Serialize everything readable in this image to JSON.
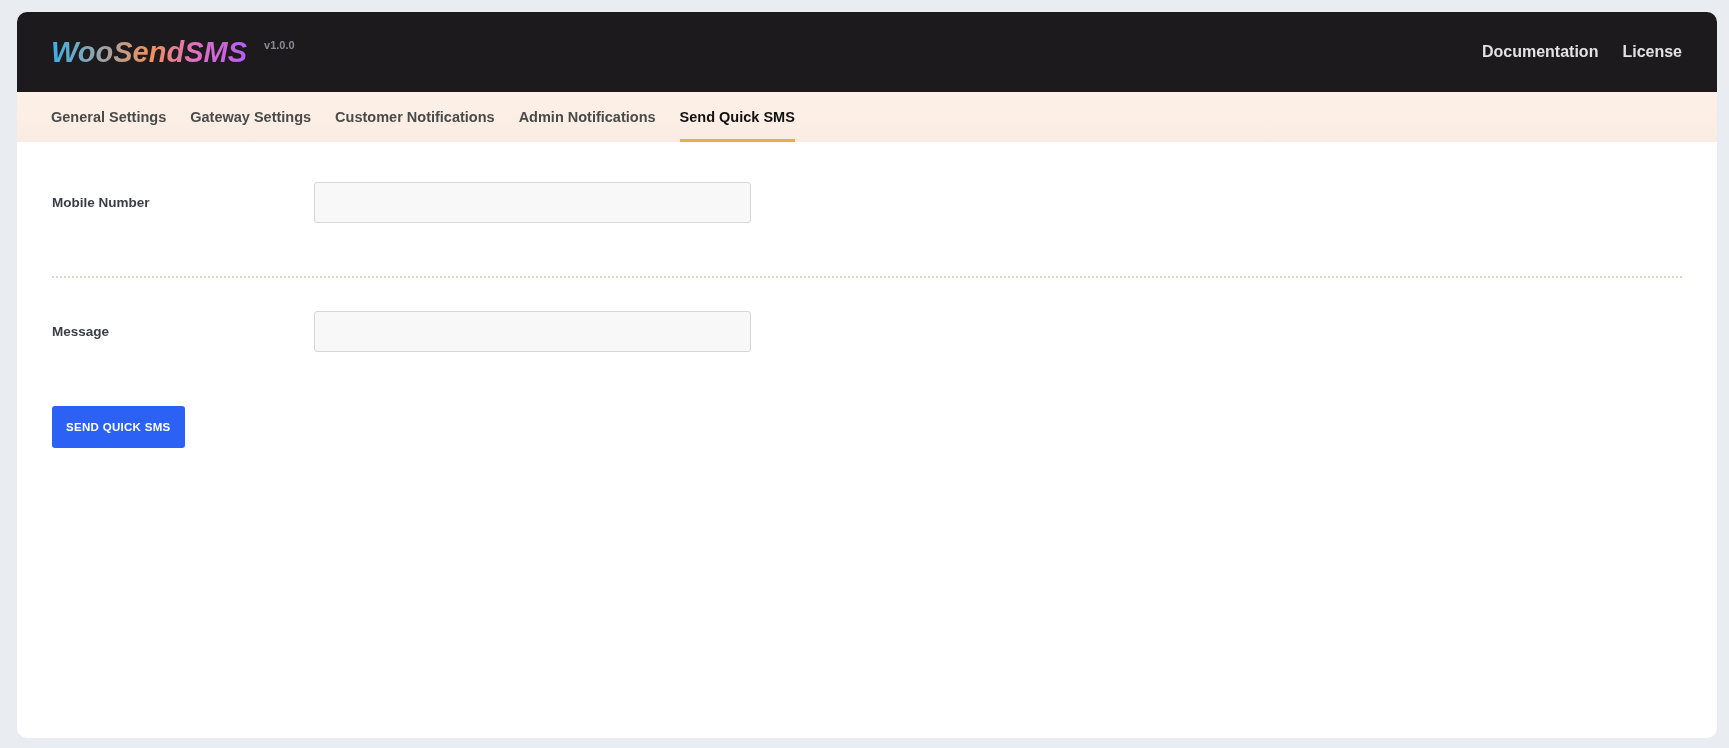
{
  "header": {
    "logo": "WooSendSMS",
    "version": "v1.0.0",
    "links": [
      "Documentation",
      "License"
    ]
  },
  "tabs": [
    {
      "label": "General Settings",
      "selected": false
    },
    {
      "label": "Gateway Settings",
      "selected": false
    },
    {
      "label": "Customer Notifications",
      "selected": false
    },
    {
      "label": "Admin Notifications",
      "selected": false
    },
    {
      "label": "Send Quick SMS",
      "selected": true
    }
  ],
  "form": {
    "fields": [
      {
        "label": "Mobile Number"
      },
      {
        "label": "Message"
      }
    ],
    "submit": "SEND QUICK SMS"
  }
}
